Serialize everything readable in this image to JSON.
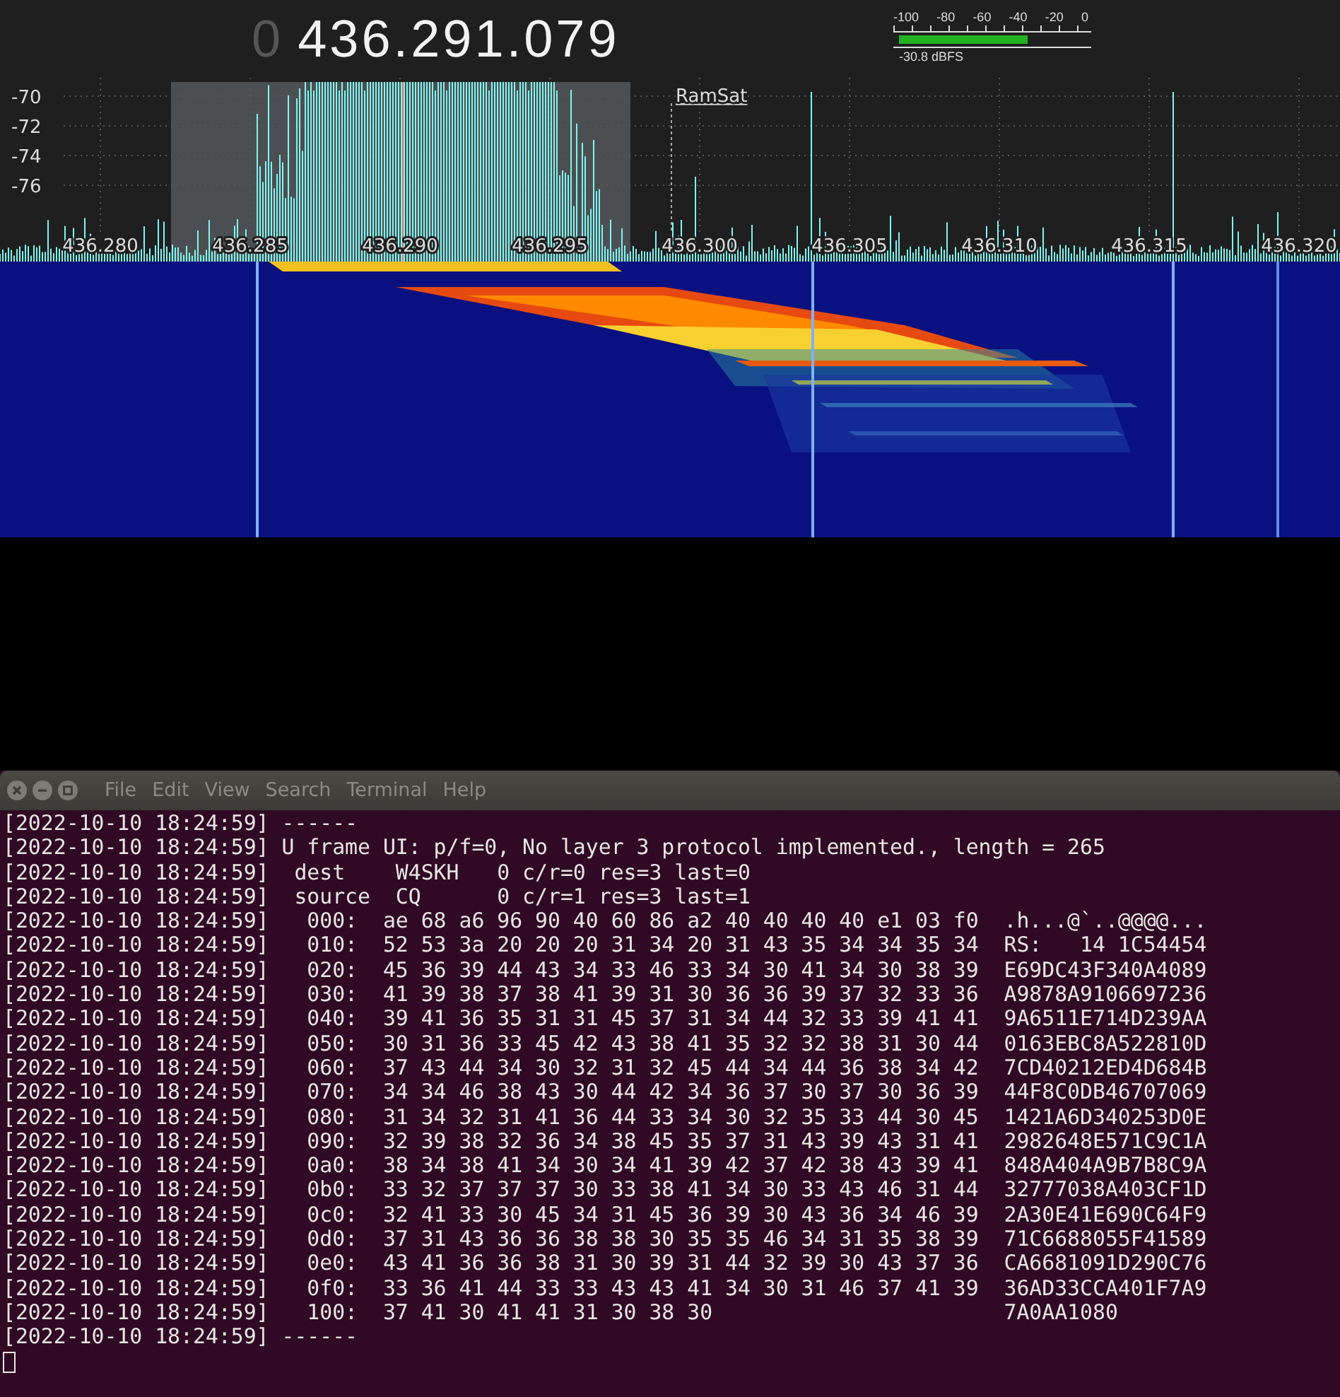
{
  "receiver": {
    "frequency_prefix": "0",
    "frequency": "436.291.079",
    "meter": {
      "ticks": [
        "-100",
        "-80",
        "-60",
        "-40",
        "-20",
        "0"
      ],
      "level": 0.69,
      "reading": "-30.8 dBFS"
    }
  },
  "spectrum": {
    "y_labels": [
      "-70",
      "-72",
      "-74",
      "-76"
    ],
    "x_labels": [
      "436.280",
      "436.285",
      "436.290",
      "436.295",
      "436.300",
      "436.305",
      "436.310",
      "436.315",
      "436.320"
    ],
    "marker_label": "RamSat"
  },
  "terminal": {
    "menu": [
      "File",
      "Edit",
      "View",
      "Search",
      "Terminal",
      "Help"
    ],
    "lines": [
      "[2022-10-10 18:24:59] ------",
      "[2022-10-10 18:24:59] U frame UI: p/f=0, No layer 3 protocol implemented., length = 265",
      "[2022-10-10 18:24:59]  dest    W4SKH   0 c/r=0 res=3 last=0",
      "[2022-10-10 18:24:59]  source  CQ      0 c/r=1 res=3 last=1",
      "[2022-10-10 18:24:59]   000:  ae 68 a6 96 90 40 60 86 a2 40 40 40 40 e1 03 f0  .h...@`..@@@@...",
      "[2022-10-10 18:24:59]   010:  52 53 3a 20 20 20 31 34 20 31 43 35 34 34 35 34  RS:   14 1C54454",
      "[2022-10-10 18:24:59]   020:  45 36 39 44 43 34 33 46 33 34 30 41 34 30 38 39  E69DC43F340A4089",
      "[2022-10-10 18:24:59]   030:  41 39 38 37 38 41 39 31 30 36 36 39 37 32 33 36  A9878A9106697236",
      "[2022-10-10 18:24:59]   040:  39 41 36 35 31 31 45 37 31 34 44 32 33 39 41 41  9A6511E714D239AA",
      "[2022-10-10 18:24:59]   050:  30 31 36 33 45 42 43 38 41 35 32 32 38 31 30 44  0163EBC8A522810D",
      "[2022-10-10 18:24:59]   060:  37 43 44 34 30 32 31 32 45 44 34 44 36 38 34 42  7CD40212ED4D684B",
      "[2022-10-10 18:24:59]   070:  34 34 46 38 43 30 44 42 34 36 37 30 37 30 36 39  44F8C0DB46707069",
      "[2022-10-10 18:24:59]   080:  31 34 32 31 41 36 44 33 34 30 32 35 33 44 30 45  1421A6D340253D0E",
      "[2022-10-10 18:24:59]   090:  32 39 38 32 36 34 38 45 35 37 31 43 39 43 31 41  2982648E571C9C1A",
      "[2022-10-10 18:24:59]   0a0:  38 34 38 41 34 30 34 41 39 42 37 42 38 43 39 41  848A404A9B7B8C9A",
      "[2022-10-10 18:24:59]   0b0:  33 32 37 37 37 30 33 38 41 34 30 33 43 46 31 44  32777038A403CF1D",
      "[2022-10-10 18:24:59]   0c0:  32 41 33 30 45 34 31 45 36 39 30 43 36 34 46 39  2A30E41E690C64F9",
      "[2022-10-10 18:24:59]   0d0:  37 31 43 36 36 38 38 30 35 35 46 34 31 35 38 39  71C6688055F41589",
      "[2022-10-10 18:24:59]   0e0:  43 41 36 36 38 31 30 39 31 44 32 39 30 43 37 36  CA6681091D290C76",
      "[2022-10-10 18:24:59]   0f0:  33 36 41 44 33 33 43 43 41 34 30 31 46 37 41 39  36AD33CCA401F7A9",
      "[2022-10-10 18:24:59]   100:  37 41 30 41 41 31 30 38 30                       7A0AA1080",
      "[2022-10-10 18:24:59] ------"
    ]
  }
}
